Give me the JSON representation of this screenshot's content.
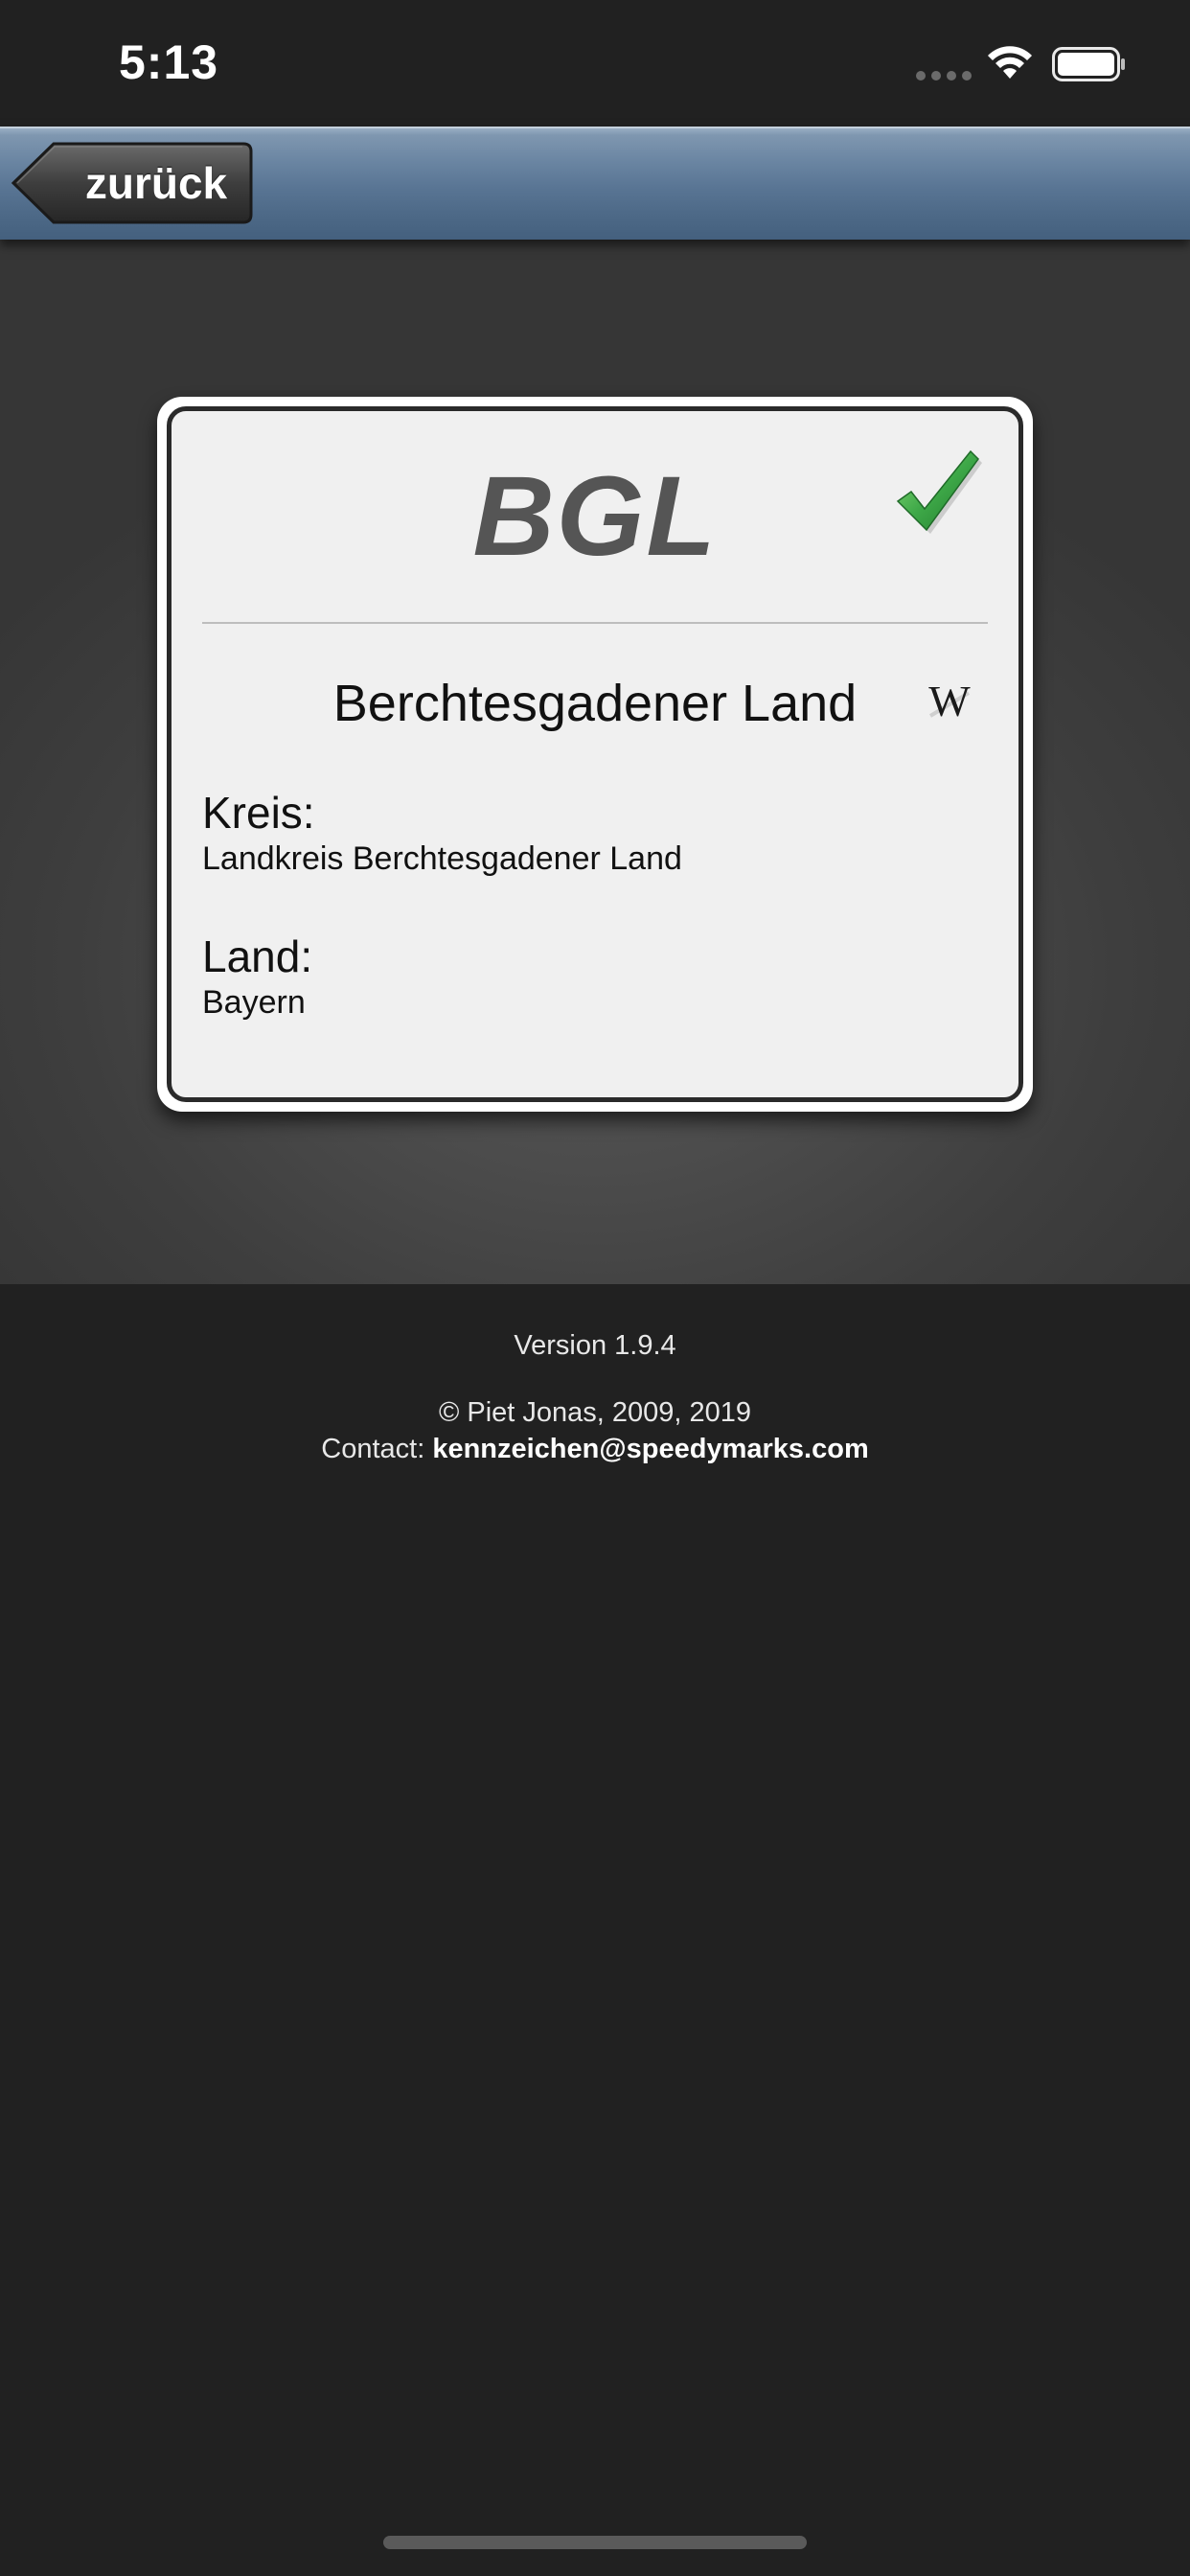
{
  "status_bar": {
    "time": "5:13",
    "icons": [
      "cellular-signal-icon",
      "wifi-icon",
      "battery-icon"
    ]
  },
  "nav": {
    "back_label": "zurück"
  },
  "plate": {
    "code": "BGL",
    "status_icon": "checkmark-icon",
    "region_name": "Berchtesgadener Land",
    "wiki_icon": "wikipedia-icon",
    "kreis_label": "Kreis:",
    "kreis_value": "Landkreis Berchtesgadener Land",
    "land_label": "Land:",
    "land_value": "Bayern"
  },
  "footer": {
    "version": "Version 1.9.4",
    "copyright": "© Piet Jonas, 2009, 2019",
    "contact_label": "Contact: ",
    "contact_email": "kennzeichen@speedymarks.com"
  },
  "colors": {
    "background": "#212121",
    "nav_bar": "#587493",
    "plate_text": "#555555",
    "check_green": "#3ea848"
  }
}
